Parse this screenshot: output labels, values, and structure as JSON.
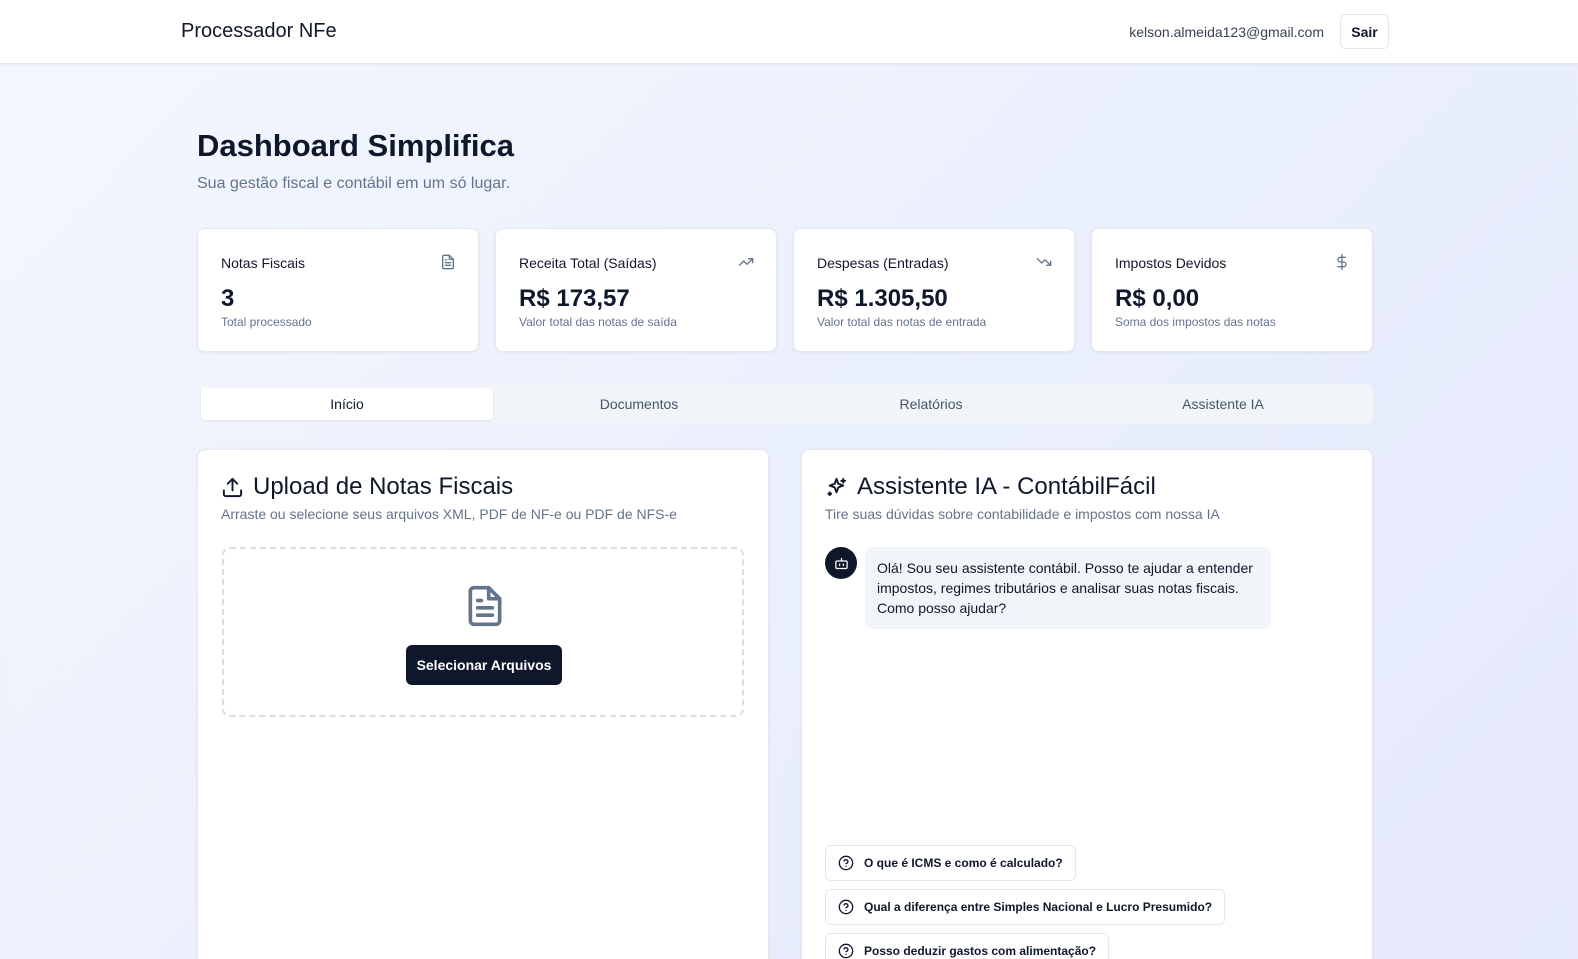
{
  "header": {
    "brand": "Processador NFe",
    "user_email": "kelson.almeida123@gmail.com",
    "logout_label": "Sair"
  },
  "page": {
    "title": "Dashboard Simplifica",
    "subtitle": "Sua gestão fiscal e contábil em um só lugar."
  },
  "stats": [
    {
      "label": "Notas Fiscais",
      "value": "3",
      "desc": "Total processado",
      "icon": "file-text-icon"
    },
    {
      "label": "Receita Total (Saídas)",
      "value": "R$ 173,57",
      "desc": "Valor total das notas de saída",
      "icon": "trending-up-icon"
    },
    {
      "label": "Despesas (Entradas)",
      "value": "R$ 1.305,50",
      "desc": "Valor total das notas de entrada",
      "icon": "trending-down-icon"
    },
    {
      "label": "Impostos Devidos",
      "value": "R$ 0,00",
      "desc": "Soma dos impostos das notas",
      "icon": "dollar-sign-icon"
    }
  ],
  "tabs": [
    {
      "label": "Início",
      "active": true
    },
    {
      "label": "Documentos",
      "active": false
    },
    {
      "label": "Relatórios",
      "active": false
    },
    {
      "label": "Assistente IA",
      "active": false
    }
  ],
  "upload": {
    "title": "Upload de Notas Fiscais",
    "desc": "Arraste ou selecione seus arquivos XML, PDF de NF-e ou PDF de NFS-e",
    "button_label": "Selecionar Arquivos"
  },
  "assistant": {
    "title": "Assistente IA - ContábilFácil",
    "desc": "Tire suas dúvidas sobre contabilidade e impostos com nossa IA",
    "greeting": "Olá! Sou seu assistente contábil. Posso te ajudar a entender impostos, regimes tributários e analisar suas notas fiscais. Como posso ajudar?",
    "suggestions": [
      "O que é ICMS e como é calculado?",
      "Qual a diferença entre Simples Nacional e Lucro Presumido?",
      "Posso deduzir gastos com alimentação?"
    ]
  },
  "colors": {
    "primary": "#0f172a",
    "muted_text": "#64748b",
    "tab_background": "#f1f5f9"
  }
}
